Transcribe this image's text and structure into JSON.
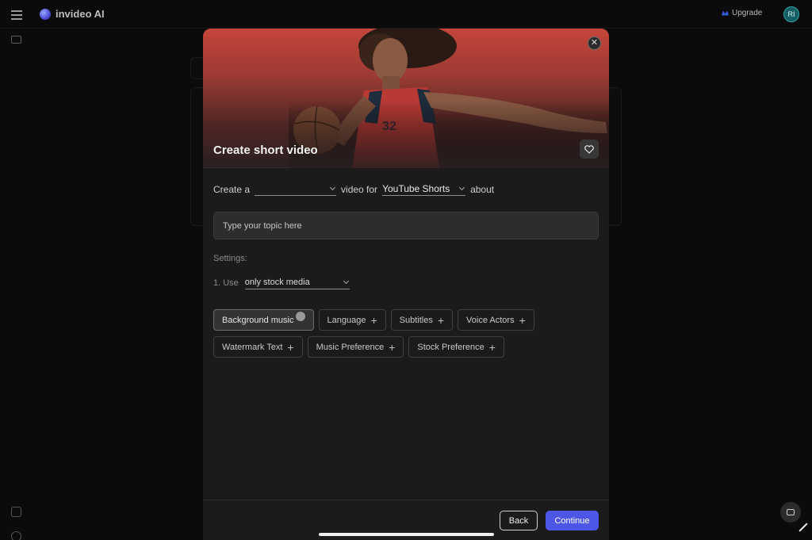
{
  "app": {
    "brand_name": "invideo AI",
    "upgrade_label": "Upgrade",
    "avatar_initials": "RI"
  },
  "modal": {
    "title": "Create short video",
    "prompt": {
      "prefix": "Create a",
      "video_type_value": "",
      "middle": "video for",
      "platform_value": "YouTube Shorts",
      "suffix": "about"
    },
    "topic_input": {
      "placeholder": "Type your topic here",
      "value": ""
    },
    "settings_label": "Settings:",
    "use_setting": {
      "label": "1. Use",
      "value": "only stock media"
    },
    "chips": [
      [
        "Background music",
        "Language",
        "Subtitles",
        "Voice Actors"
      ],
      [
        "Watermark Text",
        "Music Preference",
        "Stock Preference"
      ]
    ],
    "footer": {
      "back_label": "Back",
      "continue_label": "Continue"
    }
  },
  "icons": {
    "menu": "hamburger-icon",
    "close": "close-icon",
    "favorite": "heart-icon",
    "chat": "chat-icon"
  },
  "colors": {
    "accent": "#4c57e8",
    "modal_bg": "#1b1b1c",
    "hero_top": "#c5453a"
  }
}
